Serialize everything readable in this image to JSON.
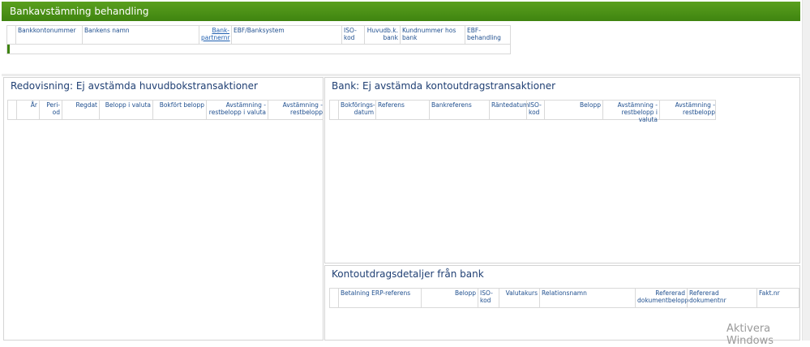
{
  "window": {
    "title": "Bankavstämning behandling"
  },
  "top_grid": {
    "columns": [
      "Bankkontonummer",
      "Bankens namn",
      "Bank-partnernr",
      "EBF/Banksystem",
      "ISO-kod",
      "Huvudb.k. bank",
      "Kundnummer hos bank",
      "EBF-behandling"
    ]
  },
  "panels": {
    "ledger": {
      "title": "Redovisning: Ej avstämda huvudbokstransaktioner",
      "columns": [
        "År",
        "Peri-od",
        "Regdat",
        "Belopp i valuta",
        "Bokfört belopp",
        "Avstämning - restbelopp i valuta",
        "Avstämning - restbelopp"
      ]
    },
    "bank": {
      "title": "Bank: Ej avstämda kontoutdragstransaktioner",
      "columns": [
        "Bokförings-datum",
        "Referens",
        "Bankreferens",
        "Räntedatum",
        "ISO-kod",
        "Belopp",
        "Avstämning - restbelopp i valuta",
        "Avstämning - restbelopp"
      ]
    },
    "details": {
      "title": "Kontoutdragsdetaljer från bank",
      "columns": [
        "Betalning ERP-referens",
        "Belopp",
        "ISO-kod",
        "Valutakurs",
        "Relationsnamn",
        "Refererad dokumentbelopp",
        "Refererad dokumentnr",
        "Fakt.nr"
      ]
    }
  },
  "watermark": "Aktivera Windows"
}
